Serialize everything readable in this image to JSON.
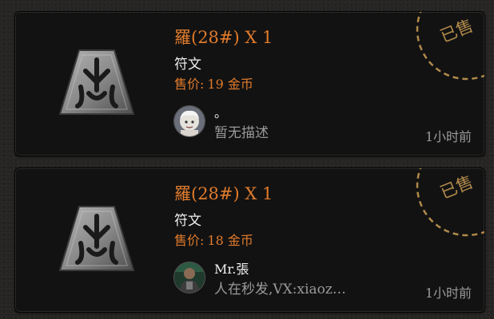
{
  "listings": [
    {
      "title": "羅(28#) X 1",
      "type": "符文",
      "price_label": "售价:",
      "price_value": "19 金币",
      "seller_name": "。",
      "seller_avatar": "cartoon-character-avatar",
      "description": "暂无描述",
      "time": "1小时前",
      "status": "已售"
    },
    {
      "title": "羅(28#) X 1",
      "type": "符文",
      "price_label": "售价:",
      "price_value": "18 金币",
      "seller_name": "Mr.張",
      "seller_avatar": "person-photo-avatar",
      "description": "人在秒发,VX:xiaoz…",
      "time": "1小时前",
      "status": "已售"
    }
  ],
  "colors": {
    "accent": "#e07b2c",
    "stamp": "#b18a4b",
    "card_bg": "#121212",
    "muted": "#9a9a9a"
  }
}
